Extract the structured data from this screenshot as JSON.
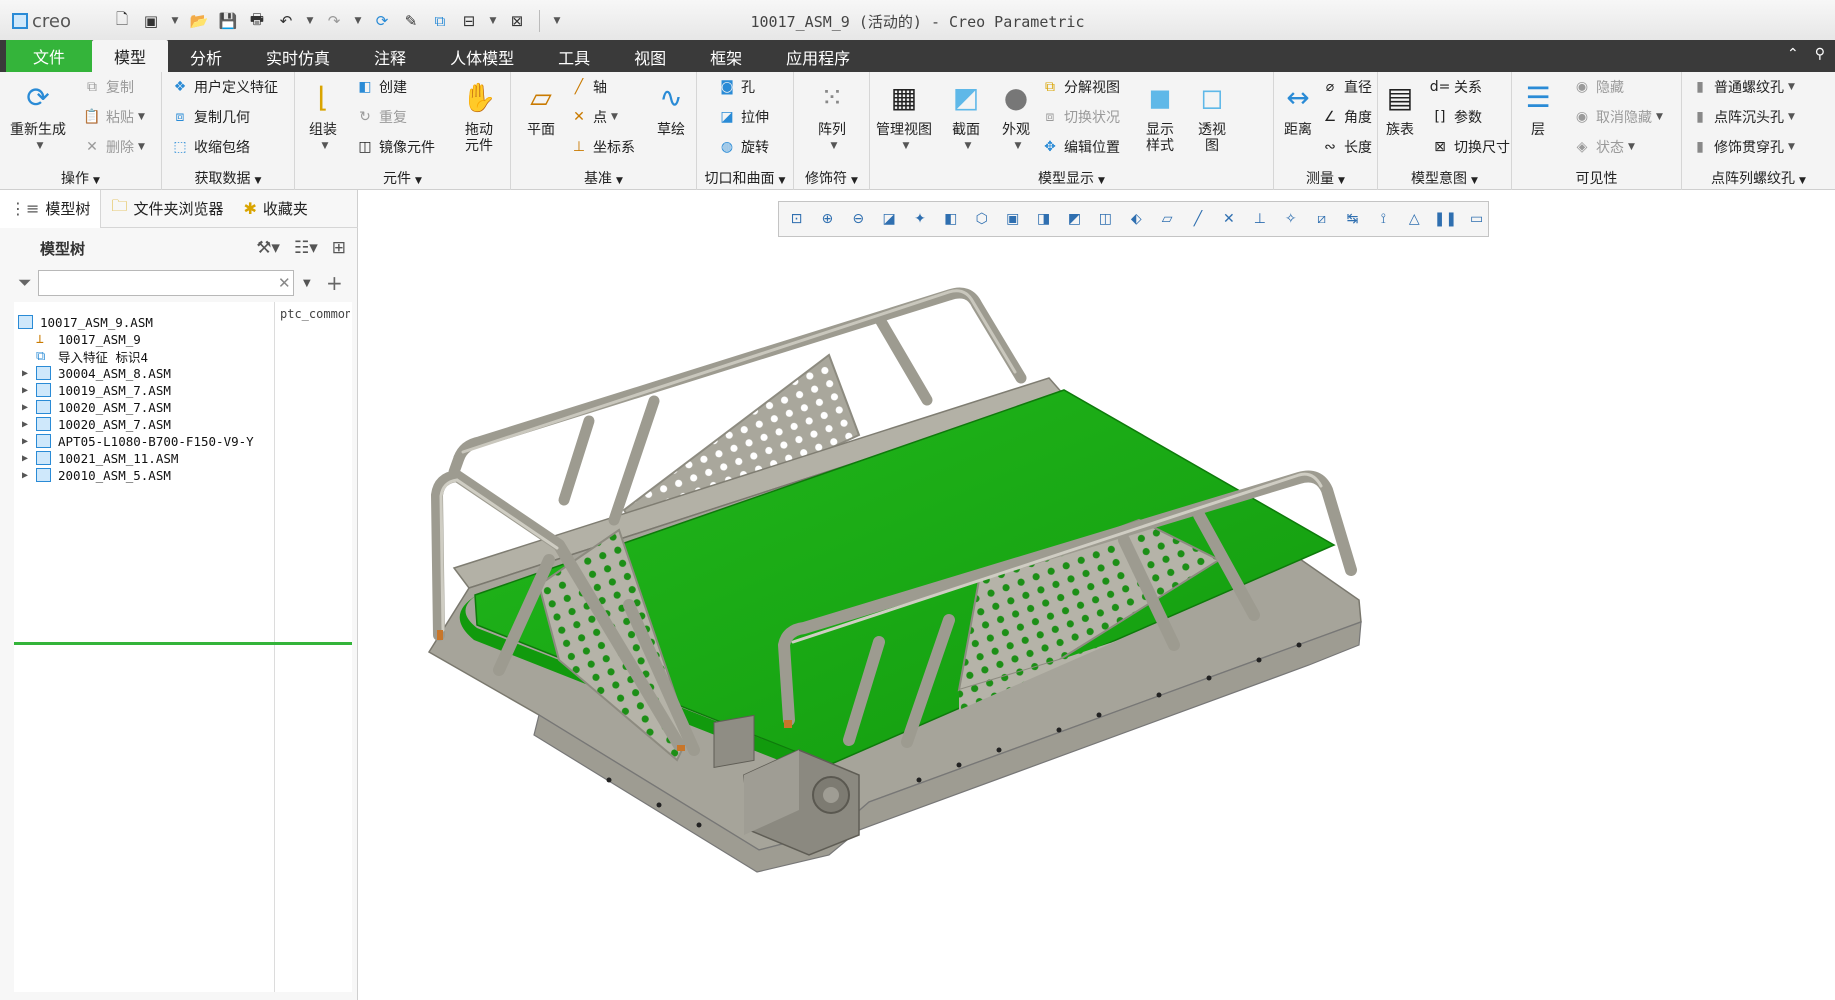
{
  "window": {
    "title": "10017_ASM_9 (活动的) - Creo Parametric",
    "logo": "creo"
  },
  "quick_access": [
    "new-icon",
    "open-icon",
    "save-icon",
    "undo-icon",
    "redo-icon",
    "regenerate-icon",
    "windows-icon",
    "close-icon"
  ],
  "menu": {
    "tabs": [
      "文件",
      "模型",
      "分析",
      "实时仿真",
      "注释",
      "人体模型",
      "工具",
      "视图",
      "框架",
      "应用程序"
    ],
    "active": "模型"
  },
  "ribbon": {
    "operations": {
      "label": "操作",
      "regenerate": "重新生成",
      "copy": "复制",
      "paste": "粘贴",
      "delete": "删除"
    },
    "get_data": {
      "label": "获取数据",
      "udf": "用户定义特征",
      "copy_geom": "复制几何",
      "shrinkwrap": "收缩包络"
    },
    "component": {
      "label": "元件",
      "assemble": "组装",
      "create": "创建",
      "repeat": "重复",
      "mirror": "镜像元件",
      "drag": "拖动元件"
    },
    "datum": {
      "label": "基准",
      "plane": "平面",
      "axis": "轴",
      "point": "点",
      "csys": "坐标系",
      "sketch": "草绘"
    },
    "cut_surface": {
      "label": "切口和曲面",
      "hole": "孔",
      "extrude": "拉伸",
      "revolve": "旋转"
    },
    "modifiers": {
      "label": "修饰符",
      "pattern": "阵列"
    },
    "model_display": {
      "label": "模型显示",
      "manage_views": "管理视图",
      "section": "截面",
      "appearance": "外观",
      "explode": "分解视图",
      "toggle_status": "切换状况",
      "edit_position": "编辑位置",
      "display_style": "显示样式",
      "perspective": "透视图"
    },
    "measure": {
      "label": "测量",
      "distance": "距离",
      "diameter": "直径",
      "angle": "角度",
      "length": "长度"
    },
    "model_intent": {
      "label": "模型意图",
      "family_table": "族表",
      "relations": "关系",
      "parameters": "参数",
      "switch_dims": "切换尺寸"
    },
    "visibility": {
      "label": "可见性",
      "layers": "层",
      "hide": "隐藏",
      "unhide": "取消隐藏",
      "status": "状态"
    },
    "cosmetic_thread": {
      "label": "点阵列螺纹孔",
      "standard": "普通螺纹孔",
      "countersunk": "点阵沉头孔",
      "through": "修饰贯穿孔"
    }
  },
  "left_panel": {
    "tabs": [
      "模型树",
      "文件夹浏览器",
      "收藏夹"
    ],
    "tree_label": "模型树",
    "filter_placeholder": "",
    "column_header": "ptc_common_name",
    "rows": [
      {
        "name": "10017_ASM_9.ASM",
        "level": 0,
        "expandable": false,
        "icon": "assembly"
      },
      {
        "name": "10017_ASM_9",
        "level": 1,
        "expandable": false,
        "icon": "csys"
      },
      {
        "name": "导入特征 标识4",
        "level": 1,
        "expandable": false,
        "icon": "import"
      },
      {
        "name": "30004_ASM_8.ASM",
        "level": 1,
        "expandable": true,
        "icon": "assembly"
      },
      {
        "name": "10019_ASM_7.ASM",
        "level": 1,
        "expandable": true,
        "icon": "assembly"
      },
      {
        "name": "10020_ASM_7.ASM",
        "level": 1,
        "expandable": true,
        "icon": "assembly"
      },
      {
        "name": "10020_ASM_7.ASM",
        "level": 1,
        "expandable": true,
        "icon": "assembly"
      },
      {
        "name": "APT05-L1080-B700-F150-V9-Y",
        "level": 1,
        "expandable": true,
        "icon": "assembly"
      },
      {
        "name": "10021_ASM_11.ASM",
        "level": 1,
        "expandable": true,
        "icon": "assembly"
      },
      {
        "name": "20010_ASM_5.ASM",
        "level": 1,
        "expandable": true,
        "icon": "assembly"
      }
    ]
  },
  "colors": {
    "accent_green": "#34b43a",
    "belt_green": "#19a416",
    "frame_gray": "#a8a69a",
    "menubar": "#3a3a3a"
  }
}
